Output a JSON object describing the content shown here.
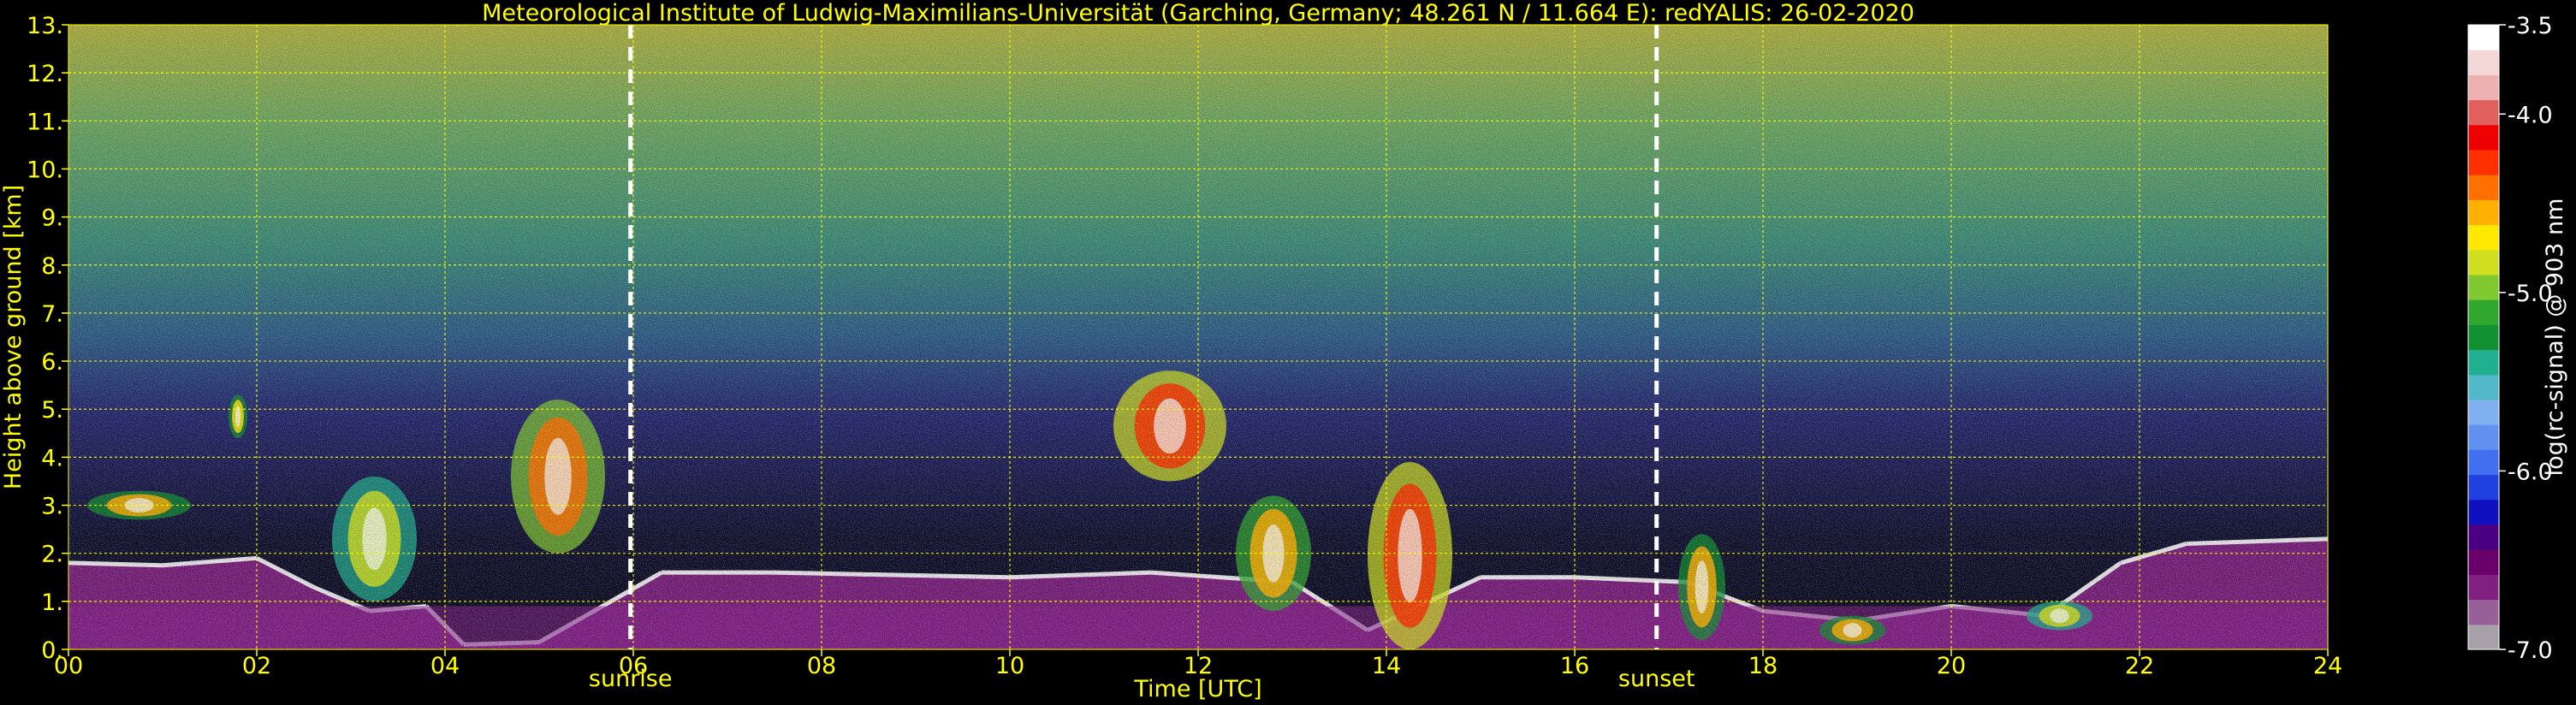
{
  "chart_data": {
    "type": "heatmap",
    "title": "Meteorological Institute of Ludwig-Maximilians-Universität (Garching, Germany; 48.261 N / 11.664 E):    redYALIS: 26-02-2020",
    "xlabel": "Time [UTC]",
    "ylabel": "Height above ground [km]",
    "xlim": [
      0,
      24
    ],
    "ylim": [
      0,
      13
    ],
    "x_ticks": [
      "00",
      "02",
      "04",
      "06",
      "08",
      "10",
      "12",
      "14",
      "16",
      "18",
      "20",
      "22",
      "24"
    ],
    "y_ticks": [
      "0.",
      "1.",
      "2.",
      "3.",
      "4.",
      "5.",
      "6.",
      "7.",
      "8.",
      "9.",
      "10.",
      "11.",
      "12.",
      "13."
    ],
    "grid": true,
    "markers": [
      {
        "label": "sunrise",
        "x": 5.97
      },
      {
        "label": "sunset",
        "x": 16.87
      }
    ],
    "colorbar": {
      "label": "log(rc-signal) @ 903 nm",
      "range": [
        -7.0,
        -3.5
      ],
      "ticks": [
        "-3.5",
        "-4.0",
        "-5.0",
        "-6.0",
        "-7.0"
      ],
      "tick_values": [
        -3.5,
        -4.0,
        -5.0,
        -6.0,
        -7.0
      ],
      "colors": [
        "#a8a0a8",
        "#986098",
        "#802080",
        "#6a006a",
        "#4a0080",
        "#1010c0",
        "#2040e0",
        "#4070f0",
        "#6090f0",
        "#80b0f0",
        "#50b8c8",
        "#20b090",
        "#109030",
        "#30a830",
        "#80c830",
        "#d0e020",
        "#ffe800",
        "#ffb000",
        "#ff7000",
        "#ff3000",
        "#ee0000",
        "#e06060",
        "#ecb0b0",
        "#f4d8d8",
        "#ffffff"
      ]
    },
    "features": {
      "boundary_layer_top_km": [
        {
          "x": 0.0,
          "h": 1.8
        },
        {
          "x": 1.0,
          "h": 1.75
        },
        {
          "x": 2.0,
          "h": 1.9
        },
        {
          "x": 2.6,
          "h": 1.3
        },
        {
          "x": 3.2,
          "h": 0.8
        },
        {
          "x": 3.8,
          "h": 0.9
        },
        {
          "x": 4.2,
          "h": 0.1
        },
        {
          "x": 5.0,
          "h": 0.15
        },
        {
          "x": 6.3,
          "h": 1.6
        },
        {
          "x": 7.5,
          "h": 1.6
        },
        {
          "x": 10.0,
          "h": 1.5
        },
        {
          "x": 11.5,
          "h": 1.6
        },
        {
          "x": 13.0,
          "h": 1.4
        },
        {
          "x": 13.8,
          "h": 0.4
        },
        {
          "x": 15.0,
          "h": 1.5
        },
        {
          "x": 16.0,
          "h": 1.5
        },
        {
          "x": 17.2,
          "h": 1.4
        },
        {
          "x": 18.0,
          "h": 0.8
        },
        {
          "x": 19.0,
          "h": 0.6
        },
        {
          "x": 20.0,
          "h": 0.9
        },
        {
          "x": 21.0,
          "h": 0.7
        },
        {
          "x": 21.8,
          "h": 1.8
        },
        {
          "x": 22.5,
          "h": 2.2
        },
        {
          "x": 24.0,
          "h": 2.3
        }
      ],
      "elevated_layers": [
        {
          "x_start": 0.2,
          "x_end": 1.3,
          "h_low": 2.7,
          "h_high": 3.3,
          "value": -4.6
        },
        {
          "x_start": 1.7,
          "x_end": 1.9,
          "h_low": 4.4,
          "h_high": 5.3,
          "value": -4.7
        },
        {
          "x_start": 2.8,
          "x_end": 3.7,
          "h_low": 1.0,
          "h_high": 3.6,
          "value": -4.8
        },
        {
          "x_start": 4.7,
          "x_end": 5.7,
          "h_low": 2.0,
          "h_high": 5.2,
          "value": -4.4
        },
        {
          "x_start": 11.1,
          "x_end": 12.3,
          "h_low": 3.5,
          "h_high": 5.8,
          "value": -4.3
        },
        {
          "x_start": 12.4,
          "x_end": 13.2,
          "h_low": 0.8,
          "h_high": 3.2,
          "value": -4.5
        },
        {
          "x_start": 13.8,
          "x_end": 14.7,
          "h_low": 0.0,
          "h_high": 3.9,
          "value": -4.3
        },
        {
          "x_start": 17.1,
          "x_end": 17.6,
          "h_low": 0.2,
          "h_high": 2.4,
          "value": -4.6
        },
        {
          "x_start": 18.6,
          "x_end": 19.3,
          "h_low": 0.1,
          "h_high": 0.7,
          "value": -4.6
        },
        {
          "x_start": 20.8,
          "x_end": 21.5,
          "h_low": 0.4,
          "h_high": 1.0,
          "value": -4.8
        }
      ]
    }
  }
}
